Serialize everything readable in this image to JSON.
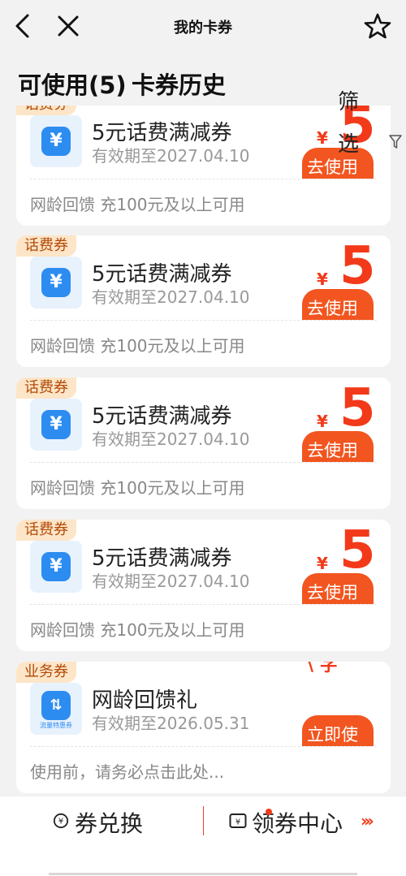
{
  "header": {
    "title": "我的卡券",
    "back_icon": "back-arrow-icon",
    "close_icon": "close-icon",
    "favorite_icon": "star-icon"
  },
  "tabs": {
    "available": "可使用(5)",
    "history": "卡券历史"
  },
  "filter": {
    "label": "筛选"
  },
  "coupons": [
    {
      "tag": "话费券",
      "title": "5元话费满减券",
      "expire": "有效期至2027.04.10",
      "desc": "网龄回馈   充100元及以上可用",
      "currency": "¥",
      "amount": "5",
      "button": "去使用",
      "icon": "yen-icon"
    },
    {
      "tag": "话费券",
      "title": "5元话费满减券",
      "expire": "有效期至2027.04.10",
      "desc": "网龄回馈   充100元及以上可用",
      "currency": "¥",
      "amount": "5",
      "button": "去使用",
      "icon": "yen-icon"
    },
    {
      "tag": "话费券",
      "title": "5元话费满减券",
      "expire": "有效期至2027.04.10",
      "desc": "网龄回馈   充100元及以上可用",
      "currency": "¥",
      "amount": "5",
      "button": "去使用",
      "icon": "yen-icon"
    },
    {
      "tag": "话费券",
      "title": "5元话费满减券",
      "expire": "有效期至2027.04.10",
      "desc": "网龄回馈   充100元及以上可用",
      "currency": "¥",
      "amount": "5",
      "button": "去使用",
      "icon": "yen-icon"
    },
    {
      "tag": "业务券",
      "title": "网龄回馈礼",
      "expire": "有效期至2026.05.31",
      "desc": "使用前，请务必点击此处...",
      "button": "立即使",
      "icon": "data-flow-icon",
      "icon_sublabel": "流量特惠券"
    }
  ],
  "bottom": {
    "exchange_label": "券兑换",
    "center_label": "领券中心",
    "exchange_icon": "exchange-icon",
    "center_icon": "coupon-ticket-icon",
    "more_icon": "double-chevron-right-icon"
  },
  "colors": {
    "accent": "#f23a1a",
    "button": "#f2551f",
    "tag_bg": "#fde5c8",
    "icon_blue": "#2d8cf0"
  }
}
